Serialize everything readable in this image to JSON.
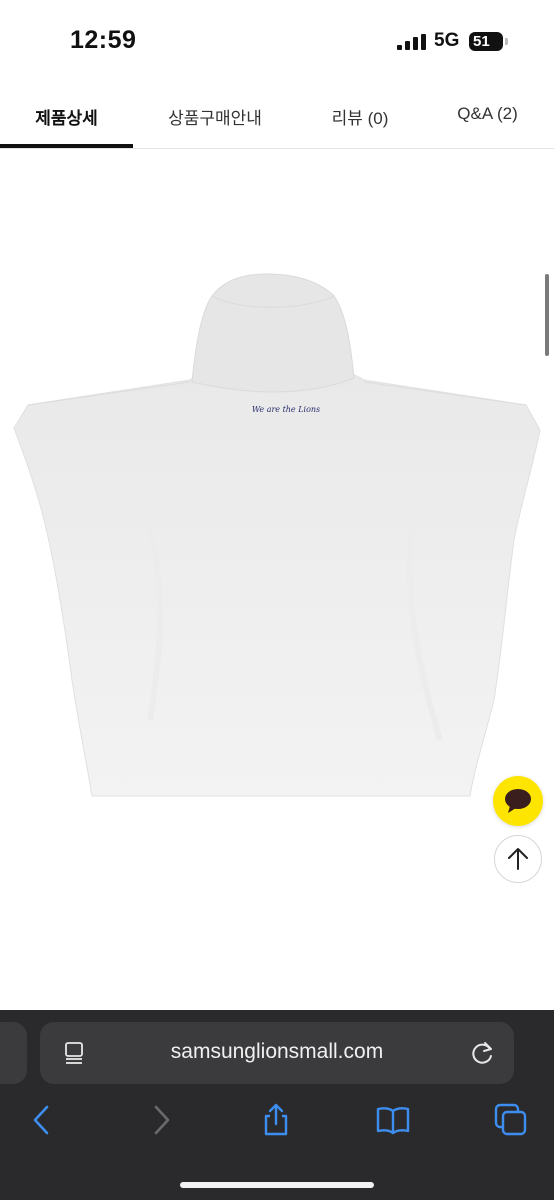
{
  "status_bar": {
    "time": "12:59",
    "network": "5G",
    "battery": "51"
  },
  "tabs": [
    {
      "label": "제품상세",
      "active": true
    },
    {
      "label": "상품구매안내",
      "active": false
    },
    {
      "label": "리뷰 (0)",
      "active": false
    },
    {
      "label": "Q&A (2)",
      "active": false
    }
  ],
  "product": {
    "print_text": "We are the Lions"
  },
  "floating": {
    "chat_icon": "chat-bubble-icon",
    "top_icon": "arrow-up-icon"
  },
  "browser": {
    "url": "samsunglionsmall.com",
    "toolbar_icons": [
      "back-icon",
      "forward-icon",
      "share-icon",
      "bookmarks-icon",
      "tabs-icon"
    ]
  },
  "colors": {
    "accent_yellow": "#fee500",
    "ios_blue": "#3d8ef0",
    "toolbar_bg": "#2a2a2c"
  }
}
